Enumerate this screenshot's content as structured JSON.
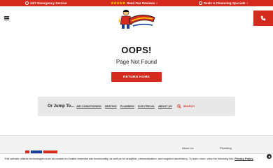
{
  "topbar": {
    "emergency": "24/7 Emergency Service",
    "reviews": "Read Our Reviews",
    "deals": "Deals & Financing Specials"
  },
  "header": {
    "logo_alt": "Action"
  },
  "main": {
    "heading": "OOPS!",
    "subheading": "Page Not Found",
    "return_button": "RETURN HOME"
  },
  "jump": {
    "title": "Or Jump To...",
    "links": [
      "AIR CONDITIONING",
      "HEATING",
      "PLUMBING",
      "ELECTRICAL",
      "ABOUT US"
    ],
    "search_label": "SEARCH"
  },
  "footer": {
    "col1": "About Us",
    "col2": "Plumbing"
  },
  "cookie": {
    "text": "This website utilizes technologies such as cookies to enable essential site functionality, as well as for analytics, personalization, and targeted advertising. To learn more, view the following link:",
    "link": "Privacy Policy"
  },
  "colors": {
    "brand_red": "#d52b1e",
    "star_yellow": "#ffd200",
    "jump_bg": "#e8e8e8"
  },
  "icons": {
    "phone": "phone-icon",
    "search": "search-icon",
    "close": "close-icon",
    "menu": "hamburger-icon"
  }
}
